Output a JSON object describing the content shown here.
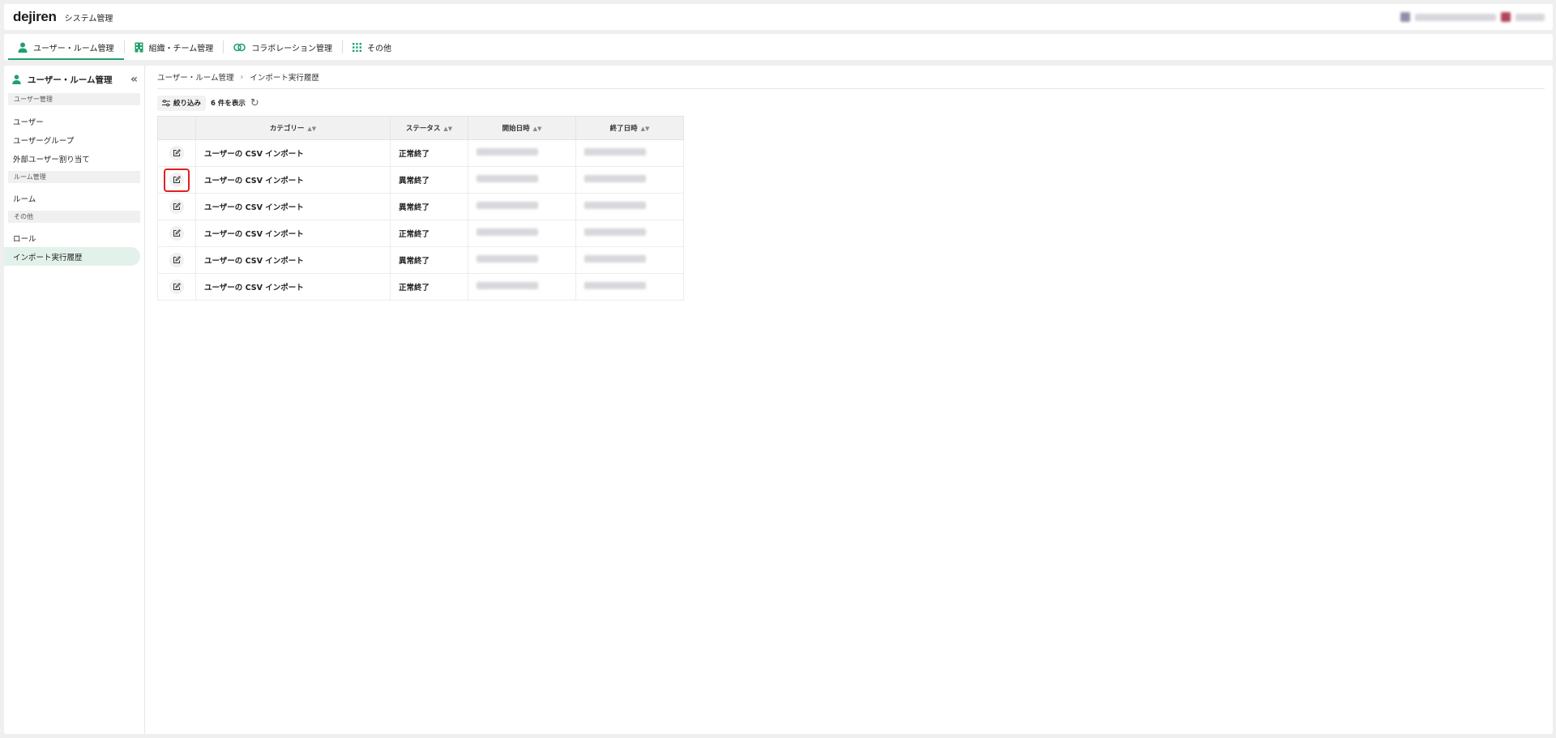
{
  "header": {
    "logo": "dejiren",
    "title": "システム管理"
  },
  "tabs": [
    {
      "label": "ユーザー・ルーム管理",
      "icon": "person-icon",
      "active": true
    },
    {
      "label": "組織・チーム管理",
      "icon": "building-icon",
      "active": false
    },
    {
      "label": "コラボレーション管理",
      "icon": "link-icon",
      "active": false
    },
    {
      "label": "その他",
      "icon": "grid-icon",
      "active": false
    }
  ],
  "sidebar": {
    "title": "ユーザー・ルーム管理",
    "sections": [
      {
        "label": "ユーザー管理",
        "items": [
          "ユーザー",
          "ユーザーグループ",
          "外部ユーザー割り当て"
        ]
      },
      {
        "label": "ルーム管理",
        "items": [
          "ルーム"
        ]
      },
      {
        "label": "その他",
        "items": [
          "ロール",
          "インポート実行履歴"
        ]
      }
    ],
    "active_item": "インポート実行履歴"
  },
  "breadcrumb": [
    "ユーザー・ルーム管理",
    "インポート実行履歴"
  ],
  "toolbar": {
    "filter_label": "絞り込み",
    "count_label": "6 件を表示"
  },
  "table": {
    "columns": [
      "カテゴリー",
      "ステータス",
      "開始日時",
      "終了日時"
    ],
    "rows": [
      {
        "category": "ユーザーの CSV インポート",
        "status": "正常終了"
      },
      {
        "category": "ユーザーの CSV インポート",
        "status": "異常終了"
      },
      {
        "category": "ユーザーの CSV インポート",
        "status": "異常終了"
      },
      {
        "category": "ユーザーの CSV インポート",
        "status": "正常終了"
      },
      {
        "category": "ユーザーの CSV インポート",
        "status": "異常終了"
      },
      {
        "category": "ユーザーの CSV インポート",
        "status": "正常終了"
      }
    ],
    "highlighted_row": 1
  },
  "colors": {
    "accent": "#22a06b",
    "highlight": "#e02020",
    "active_bg": "#e2f1ea"
  }
}
